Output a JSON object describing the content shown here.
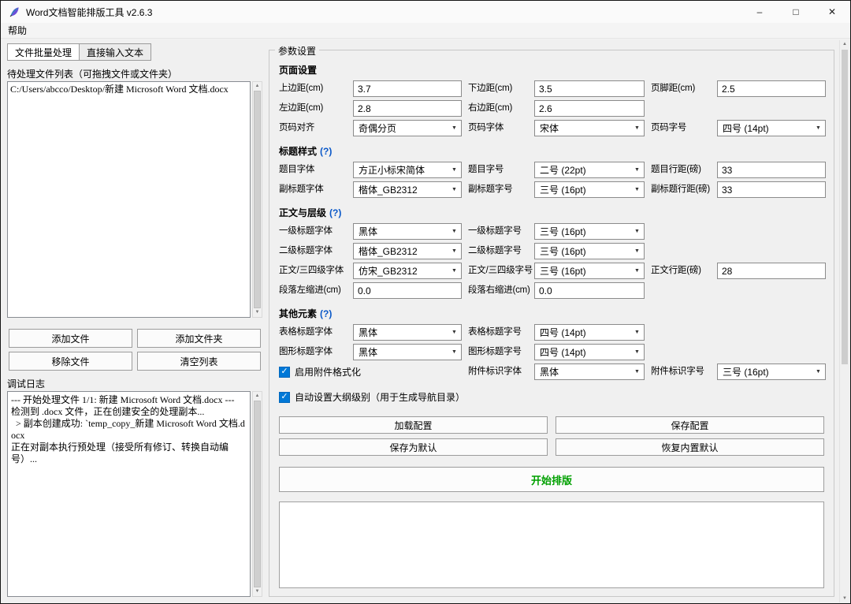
{
  "icons": {
    "check": "✓",
    "chevron_down": "▼",
    "scroll_up": "▲",
    "scroll_down": "▼",
    "minimize": "–",
    "maximize": "□",
    "close": "✕"
  },
  "colors": {
    "start_button_green": "#00a000",
    "checkbox_blue": "#0078d7",
    "help_link_blue": "#0a58c8"
  },
  "window": {
    "title": "Word文档智能排版工具 v2.6.3"
  },
  "menubar": {
    "help": "帮助"
  },
  "left_panel": {
    "tabs": {
      "batch": "文件批量处理",
      "direct_input": "直接输入文本"
    },
    "file_list_label": "待处理文件列表（可拖拽文件或文件夹）",
    "file_items": [
      "C:/Users/abcco/Desktop/新建 Microsoft Word 文档.docx"
    ],
    "buttons": {
      "add_file": "添加文件",
      "add_folder": "添加文件夹",
      "remove_file": "移除文件",
      "clear_list": "清空列表"
    },
    "debug_log_label": "调试日志",
    "debug_log": "--- 开始处理文件 1/1: 新建 Microsoft Word 文档.docx ---\n检测到 .docx 文件，正在创建安全的处理副本...\n  > 副本创建成功: `temp_copy_新建 Microsoft Word 文档.docx\n正在对副本执行预处理（接受所有修订、转换自动编号）..."
  },
  "params": {
    "frame_label": "参数设置",
    "help_mark": "(?)",
    "page": {
      "title": "页面设置",
      "top": {
        "label": "上边距(cm)",
        "value": "3.7"
      },
      "bottom": {
        "label": "下边距(cm)",
        "value": "3.5"
      },
      "footer": {
        "label": "页脚距(cm)",
        "value": "2.5"
      },
      "left": {
        "label": "左边距(cm)",
        "value": "2.8"
      },
      "right": {
        "label": "右边距(cm)",
        "value": "2.6"
      },
      "num_align": {
        "label": "页码对齐",
        "value": "奇偶分页"
      },
      "num_font": {
        "label": "页码字体",
        "value": "宋体"
      },
      "num_size": {
        "label": "页码字号",
        "value": "四号 (14pt)"
      }
    },
    "title_style": {
      "title": "标题样式",
      "doc_title_font": {
        "label": "题目字体",
        "value": "方正小标宋简体"
      },
      "doc_title_size": {
        "label": "题目字号",
        "value": "二号 (22pt)"
      },
      "doc_title_leading": {
        "label": "题目行距(磅)",
        "value": "33"
      },
      "subtitle_font": {
        "label": "副标题字体",
        "value": "楷体_GB2312"
      },
      "subtitle_size": {
        "label": "副标题字号",
        "value": "三号 (16pt)"
      },
      "subtitle_leading": {
        "label": "副标题行距(磅)",
        "value": "33"
      }
    },
    "body_levels": {
      "title": "正文与层级",
      "h1_font": {
        "label": "一级标题字体",
        "value": "黑体"
      },
      "h1_size": {
        "label": "一级标题字号",
        "value": "三号 (16pt)"
      },
      "h2_font": {
        "label": "二级标题字体",
        "value": "楷体_GB2312"
      },
      "h2_size": {
        "label": "二级标题字号",
        "value": "三号 (16pt)"
      },
      "body_font": {
        "label": "正文/三四级字体",
        "value": "仿宋_GB2312"
      },
      "body_size": {
        "label": "正文/三四级字号",
        "value": "三号 (16pt)"
      },
      "body_leading": {
        "label": "正文行距(磅)",
        "value": "28"
      },
      "indent_left": {
        "label": "段落左缩进(cm)",
        "value": "0.0"
      },
      "indent_right": {
        "label": "段落右缩进(cm)",
        "value": "0.0"
      }
    },
    "other": {
      "title": "其他元素",
      "table_font": {
        "label": "表格标题字体",
        "value": "黑体"
      },
      "table_size": {
        "label": "表格标题字号",
        "value": "四号 (14pt)"
      },
      "figure_font": {
        "label": "图形标题字体",
        "value": "黑体"
      },
      "figure_size": {
        "label": "图形标题字号",
        "value": "四号 (14pt)"
      },
      "attachment_toggle": {
        "label": "启用附件格式化",
        "checked": true
      },
      "attachment_font": {
        "label": "附件标识字体",
        "value": "黑体"
      },
      "attachment_size": {
        "label": "附件标识字号",
        "value": "三号 (16pt)"
      },
      "outline_toggle": {
        "label": "自动设置大纲级别（用于生成导航目录）",
        "checked": true
      }
    },
    "config_buttons": {
      "load": "加载配置",
      "save": "保存配置",
      "save_default": "保存为默认",
      "restore_default": "恢复内置默认"
    },
    "start_button": "开始排版"
  }
}
